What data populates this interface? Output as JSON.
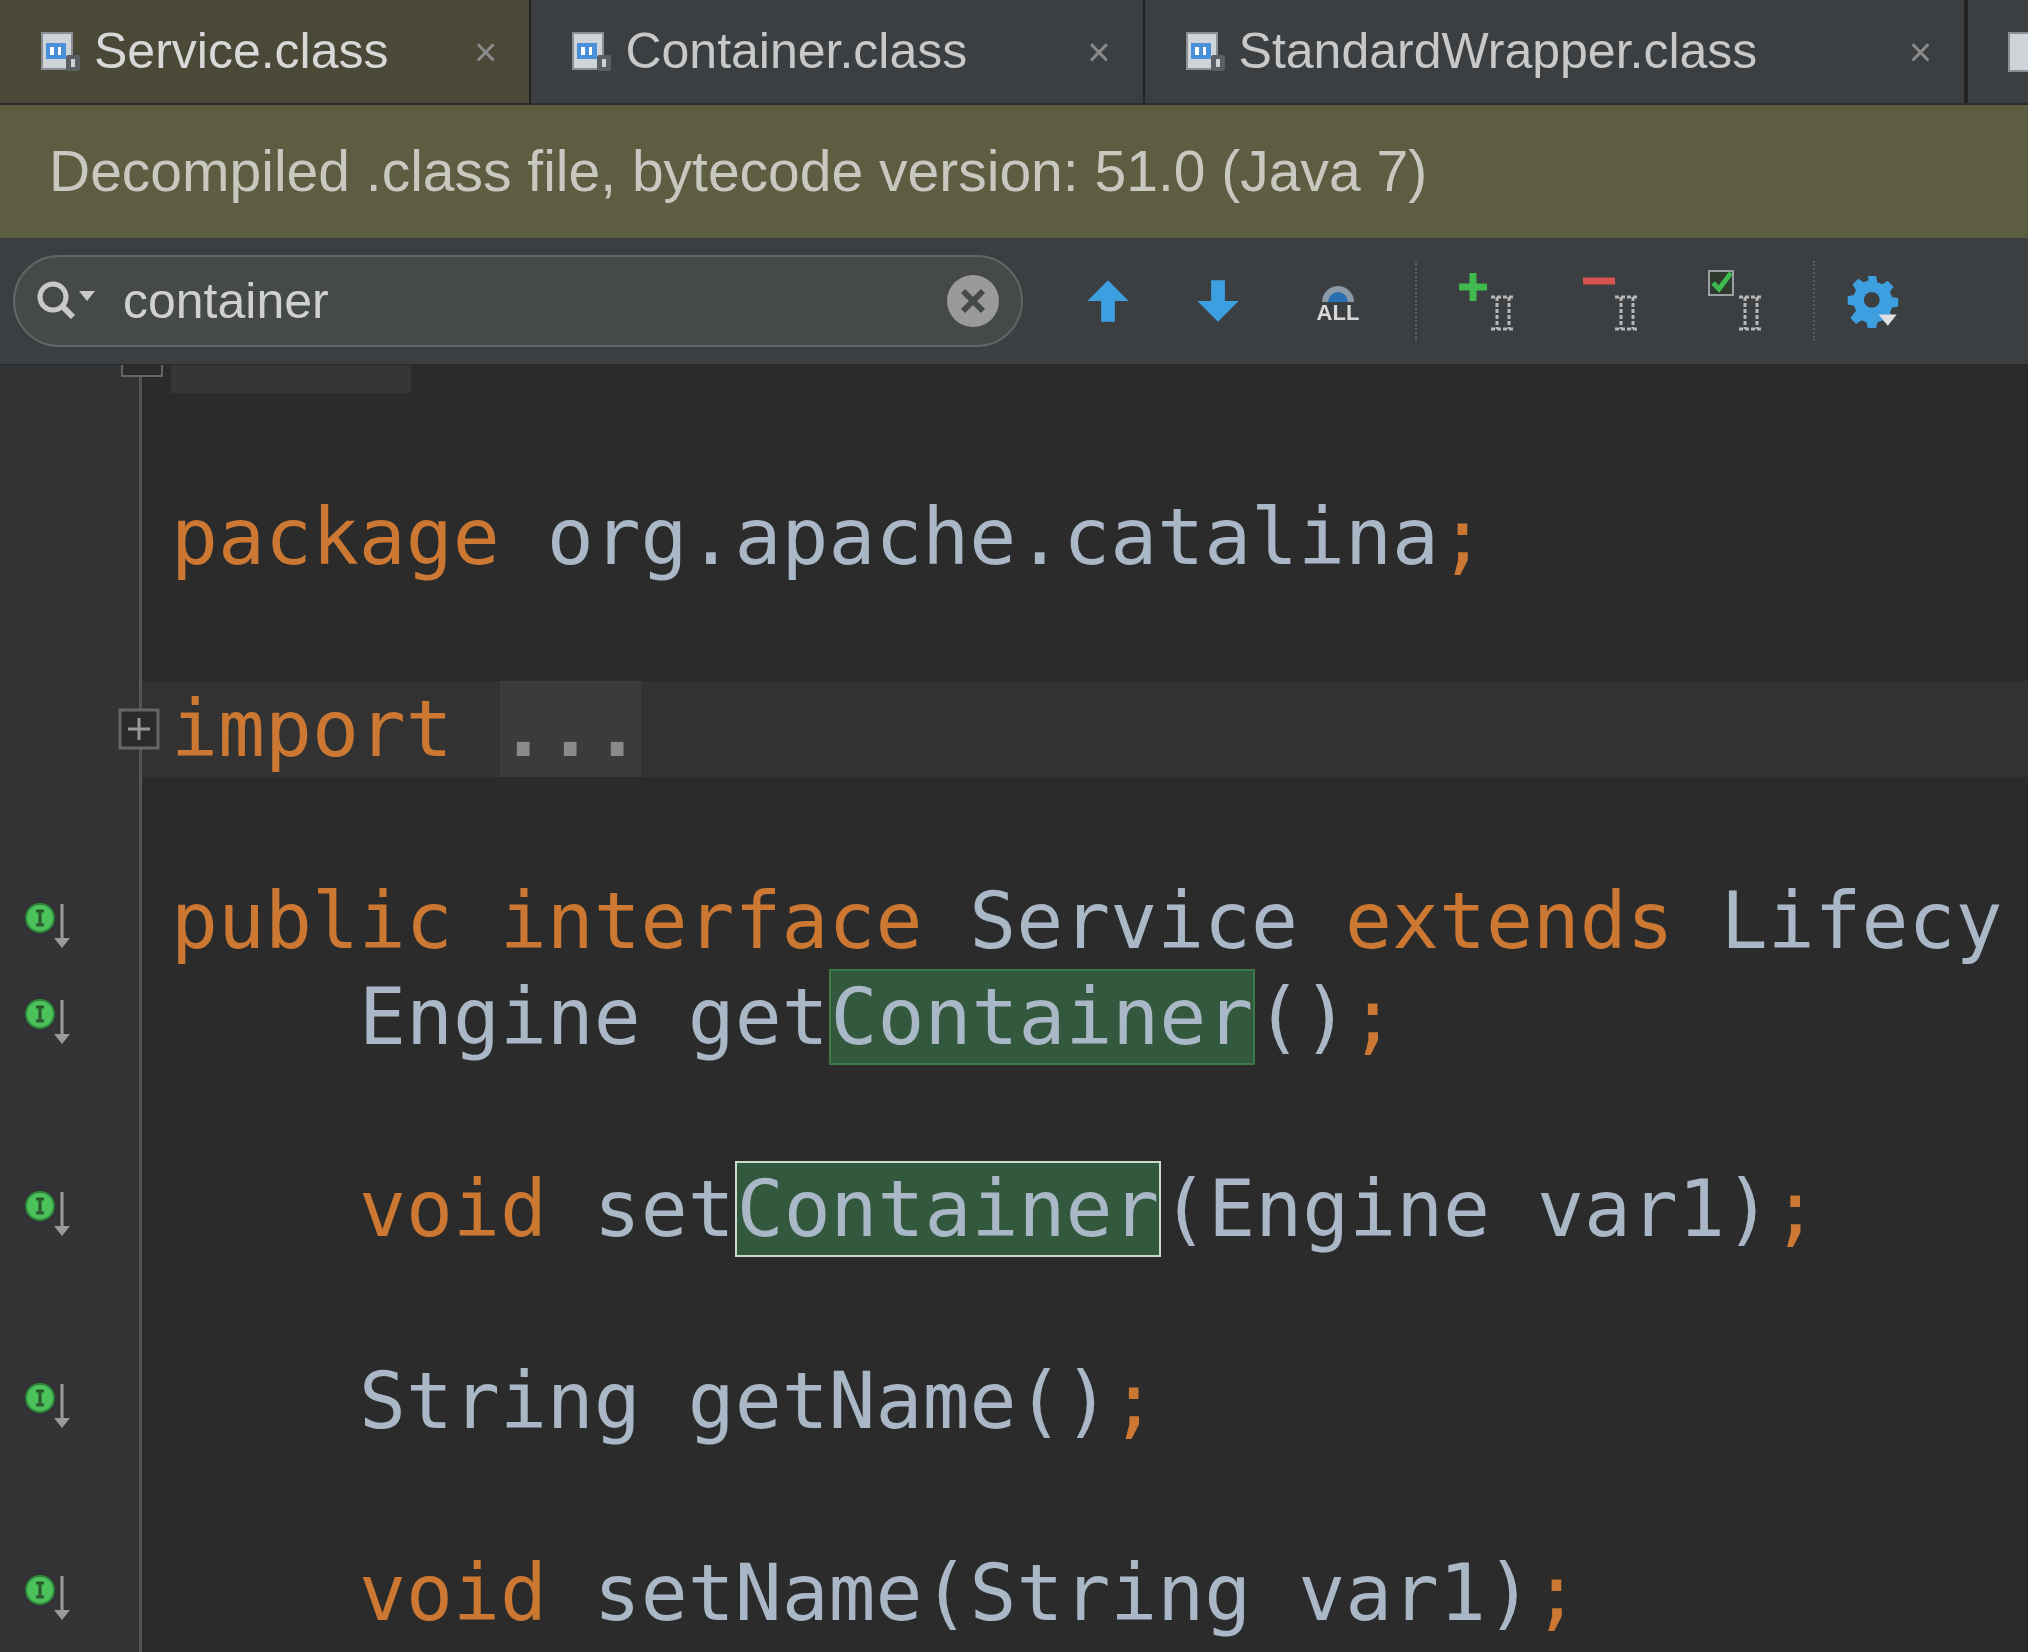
{
  "tabs": [
    {
      "label": "Service.class",
      "selected": true,
      "close": "×"
    },
    {
      "label": "Container.class",
      "selected": false,
      "close": "×"
    },
    {
      "label": "StandardWrapper.class",
      "selected": false,
      "close": "×"
    }
  ],
  "banner": {
    "text": "Decompiled .class file, bytecode version: 51.0 (Java 7)"
  },
  "search": {
    "value": "container",
    "tools": [
      {
        "kind": "prev"
      },
      {
        "kind": "next"
      },
      {
        "kind": "select_all",
        "label": "ALL"
      },
      {
        "kind": "separator"
      },
      {
        "kind": "add"
      },
      {
        "kind": "remove"
      },
      {
        "kind": "toggle"
      },
      {
        "kind": "separator"
      },
      {
        "kind": "settings"
      }
    ]
  },
  "lines": [
    {
      "kind": "fold_end"
    },
    {
      "kind": "blank"
    },
    {
      "kind": "code",
      "current": false,
      "indent": false,
      "tokens": [
        {
          "kind": "keyword",
          "text": "package"
        },
        {
          "kind": "plain",
          "text": " org.apache.catalina"
        },
        {
          "kind": "keyword",
          "text": ";"
        }
      ]
    },
    {
      "kind": "blank"
    },
    {
      "kind": "code",
      "current": true,
      "indent": false,
      "folded": true,
      "tokens": [
        {
          "kind": "keyword",
          "text": "import"
        },
        {
          "kind": "fold",
          "text": "..."
        }
      ]
    },
    {
      "kind": "blank"
    },
    {
      "kind": "code",
      "current": false,
      "indent": false,
      "marker": true,
      "tokens": [
        {
          "kind": "keyword",
          "text": "public interface"
        },
        {
          "kind": "plain",
          "text": " Service "
        },
        {
          "kind": "keyword",
          "text": "extends"
        },
        {
          "kind": "plain",
          "text": " Lifecy"
        }
      ]
    },
    {
      "kind": "code",
      "current": false,
      "indent": true,
      "marker": true,
      "tokens": [
        {
          "kind": "plain",
          "text": "Engine get"
        },
        {
          "kind": "match",
          "text": "Container",
          "selected": false
        },
        {
          "kind": "plain",
          "text": "()"
        },
        {
          "kind": "keyword",
          "text": ";"
        }
      ]
    },
    {
      "kind": "blank"
    },
    {
      "kind": "code",
      "current": false,
      "indent": true,
      "marker": true,
      "tokens": [
        {
          "kind": "keyword",
          "text": "void"
        },
        {
          "kind": "plain",
          "text": " set"
        },
        {
          "kind": "match",
          "text": "Container",
          "selected": true
        },
        {
          "kind": "plain",
          "text": "(Engine var1)"
        },
        {
          "kind": "keyword",
          "text": ";"
        }
      ]
    },
    {
      "kind": "blank"
    },
    {
      "kind": "code",
      "current": false,
      "indent": true,
      "marker": true,
      "tokens": [
        {
          "kind": "plain",
          "text": "String getName()"
        },
        {
          "kind": "keyword",
          "text": ";"
        }
      ]
    },
    {
      "kind": "blank"
    },
    {
      "kind": "code",
      "current": false,
      "indent": true,
      "marker": true,
      "tokens": [
        {
          "kind": "keyword",
          "text": "void"
        },
        {
          "kind": "plain",
          "text": " setName(String var1)"
        },
        {
          "kind": "keyword",
          "text": ";"
        }
      ]
    }
  ]
}
